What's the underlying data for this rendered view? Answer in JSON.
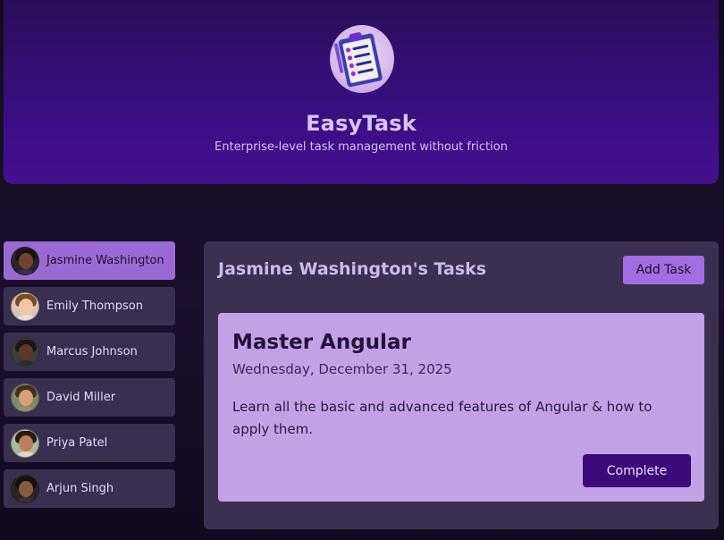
{
  "header": {
    "logo_icon": "clipboard-checklist-icon",
    "title": "EasyTask",
    "subtitle": "Enterprise-level task management without friction"
  },
  "users": [
    {
      "name": "Jasmine Washington",
      "selected": true
    },
    {
      "name": "Emily Thompson",
      "selected": false
    },
    {
      "name": "Marcus Johnson",
      "selected": false
    },
    {
      "name": "David Miller",
      "selected": false
    },
    {
      "name": "Priya Patel",
      "selected": false
    },
    {
      "name": "Arjun Singh",
      "selected": false
    }
  ],
  "tasks_panel": {
    "title": "Jasmine Washington's Tasks",
    "add_task_label": "Add Task",
    "task": {
      "title": "Master Angular",
      "due_date": "Wednesday, December 31, 2025",
      "description": "Learn all the basic and advanced features of Angular & how to apply them.",
      "complete_label": "Complete"
    }
  },
  "colors": {
    "header_bg": "#3b0f86",
    "selected_user_bg": "#9a6ad4",
    "panel_bg": "#3c3050",
    "task_card_bg": "#c2a1e6",
    "complete_button_bg": "#3a0b78"
  }
}
